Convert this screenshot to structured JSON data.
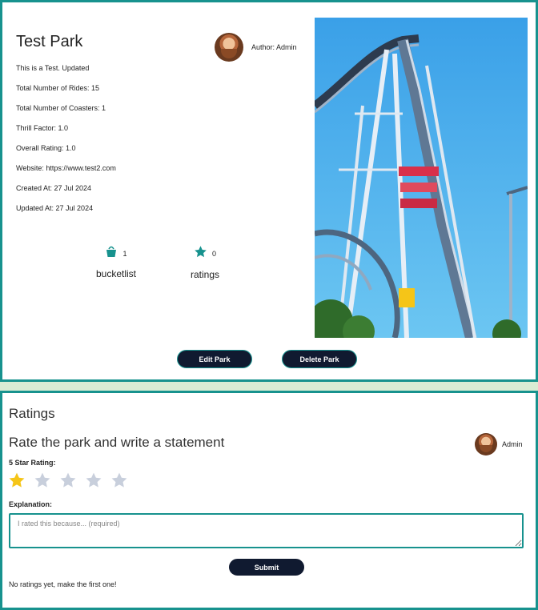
{
  "park": {
    "title": "Test Park",
    "author_label": "Author: Admin",
    "info": [
      "This is a Test. Updated",
      "Total Number of Rides: 15",
      "Total Number of Coasters: 1",
      "Thrill Factor: 1.0",
      "Overall Rating: 1.0",
      "Website: https://www.test2.com",
      "Created At: 27 Jul 2024",
      "Updated At: 27 Jul 2024"
    ],
    "bucketlist": {
      "count": "1",
      "label": "bucketlist",
      "icon": "bucket-icon"
    },
    "ratings": {
      "count": "0",
      "label": "ratings",
      "icon": "star-icon"
    },
    "edit_label": "Edit Park",
    "delete_label": "Delete Park"
  },
  "ratings_section": {
    "heading": "Ratings",
    "form_heading": "Rate the park and write a statement",
    "author_label": "Admin",
    "star_label": "5 Star Rating:",
    "selected_stars": 1,
    "max_stars": 5,
    "explanation_label": "Explanation:",
    "explanation_placeholder": "I rated this because... (required)",
    "submit_label": "Submit",
    "empty_text": "No ratings yet, make the first one!"
  },
  "colors": {
    "accent": "#17928e",
    "button_bg": "#101a30",
    "star_active": "#f5c518",
    "star_inactive": "#c8cfdc",
    "page_bg": "#d9ecd4"
  }
}
